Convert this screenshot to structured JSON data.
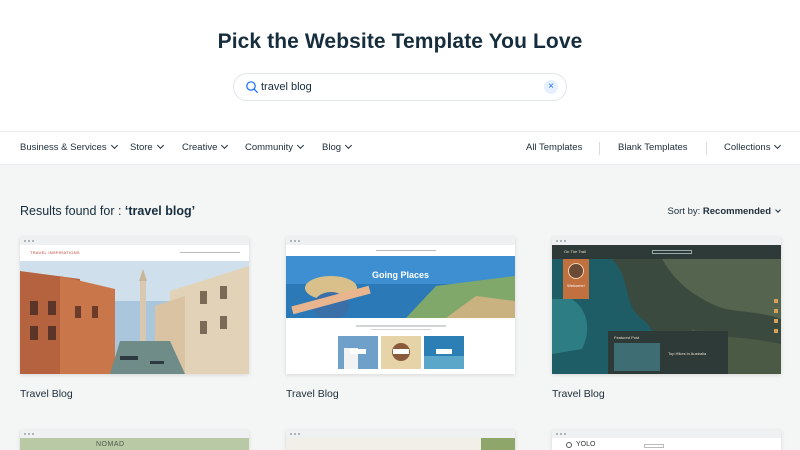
{
  "header": {
    "title": "Pick the Website Template You Love"
  },
  "search": {
    "value": "travel blog",
    "clear": "×"
  },
  "nav": {
    "categories": [
      "Business & Services",
      "Store",
      "Creative",
      "Community",
      "Blog"
    ],
    "right": [
      "All Templates",
      "Blank Templates",
      "Collections"
    ]
  },
  "results": {
    "prefix": "Results found for : ",
    "query": "‘travel blog’"
  },
  "sort": {
    "label": "Sort by: ",
    "value": "Recommended"
  },
  "cards": [
    {
      "title": "Travel Blog",
      "logo": "TRAVEL INSPIRATIONS"
    },
    {
      "title": "Travel Blog",
      "headline": "Going Places"
    },
    {
      "title": "Travel Blog",
      "logo": "On The Trail",
      "welcome": "Welcome!",
      "featured": "Featured Post",
      "post": "Top Hikes in Australia"
    }
  ],
  "bottom_cards": [
    {
      "logo": "NOMAD"
    },
    {
      "logo": ""
    },
    {
      "logo": "YOLO"
    }
  ],
  "colors": {
    "accent": "#116dff",
    "text": "#162d3d",
    "bg": "#f4f5f5"
  }
}
